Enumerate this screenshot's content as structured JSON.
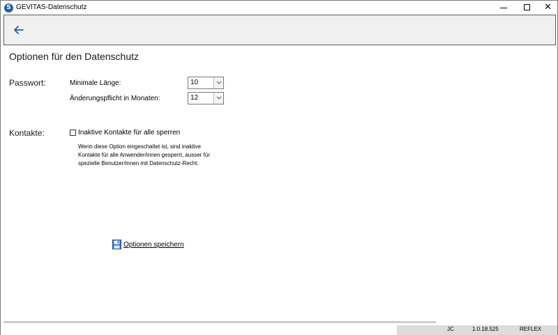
{
  "window": {
    "title": "GEVITAS-Datenschutz",
    "app_icon": "gevitas-logo-icon"
  },
  "page": {
    "title": "Optionen für den Datenschutz"
  },
  "passwort": {
    "label": "Passwort:",
    "min_length_label": "Minimale Länge:",
    "min_length_value": "10",
    "change_label": "Änderungspflicht in Monaten:",
    "change_value": "12"
  },
  "kontakte": {
    "label": "Kontakte:",
    "checkbox_label": "Inaktive Kontakte für alle sperren",
    "checkbox_checked": false,
    "description_lines": [
      "Wenn diese Option eingeschaltet ist, sind inaktive",
      "Kontakte für alle Anwender/innen gesperrt, ausser für",
      "spezielle Benutzer/innen mit Datenschutz-Recht."
    ]
  },
  "actions": {
    "save_label": "Optionen speichern",
    "save_icon": "floppy-disk-icon"
  },
  "status": {
    "user": "JC",
    "version": "1.0.18.525",
    "database": "REFLEX"
  },
  "colors": {
    "toolbar_bg": "#f0f0f0",
    "back_arrow": "#1f5fa8",
    "status_bg": "#dcdcdc"
  }
}
